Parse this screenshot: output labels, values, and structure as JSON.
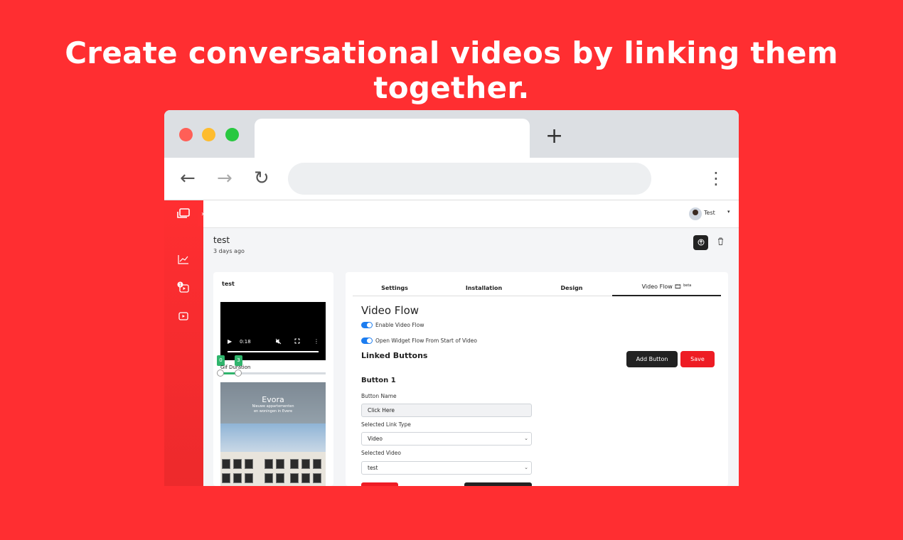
{
  "headline": "Create conversational videos by linking them together.",
  "browser": {
    "new_tab_icon": "+",
    "back_icon": "←",
    "forward_icon": "→",
    "reload_icon": "↻",
    "menu_icon": "⋮"
  },
  "user": {
    "name": "Test",
    "caret": "▾"
  },
  "project": {
    "title": "test",
    "time": "3 days ago"
  },
  "left_card": {
    "title": "test",
    "video_time": "0:18",
    "gif_duration_label": "Gif Duration",
    "range_start": "0",
    "range_end": "3",
    "thumbnail_heading": "Evora",
    "thumbnail_sub1": "Nieuwe appartementen",
    "thumbnail_sub2": "en woningen in Evere"
  },
  "tabs": [
    {
      "label": "Settings"
    },
    {
      "label": "Installation"
    },
    {
      "label": "Design"
    },
    {
      "label": "Video Flow",
      "badge": "beta"
    }
  ],
  "video_flow": {
    "title": "Video Flow",
    "enable_label": "Enable Video Flow",
    "open_label": "Open Widget Flow From Start of Video",
    "linked_buttons_title": "Linked Buttons",
    "add_button_label": "Add Button",
    "save_label": "Save",
    "button1": {
      "title": "Button 1",
      "name_label": "Button Name",
      "name_value": "Click Here",
      "link_type_label": "Selected Link Type",
      "link_type_value": "Video",
      "video_label": "Selected Video",
      "video_value": "test"
    }
  },
  "colors": {
    "accent": "#ff2e31",
    "toggle": "#1c7df0",
    "range": "#2fb56c"
  }
}
